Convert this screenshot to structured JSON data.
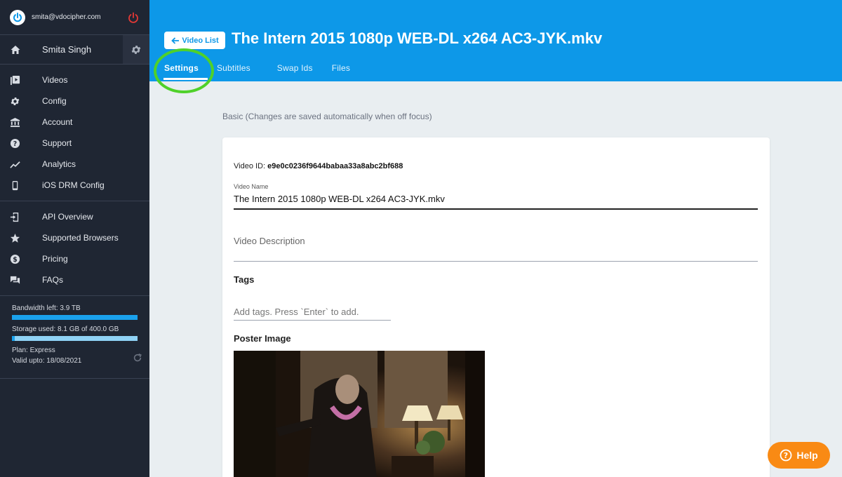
{
  "account": {
    "email": "smita@vdocipher.com"
  },
  "user": {
    "name": "Smita Singh"
  },
  "nav_primary": [
    {
      "label": "Videos",
      "icon": "video-library-icon"
    },
    {
      "label": "Config",
      "icon": "gear-icon"
    },
    {
      "label": "Account",
      "icon": "bank-icon"
    },
    {
      "label": "Support",
      "icon": "help-circle-icon"
    },
    {
      "label": "Analytics",
      "icon": "trend-line-icon"
    },
    {
      "label": "iOS DRM Config",
      "icon": "phone-icon"
    }
  ],
  "nav_secondary": [
    {
      "label": "API Overview",
      "icon": "api-door-icon"
    },
    {
      "label": "Supported Browsers",
      "icon": "star-icon"
    },
    {
      "label": "Pricing",
      "icon": "dollar-circle-icon"
    },
    {
      "label": "FAQs",
      "icon": "forum-icon"
    }
  ],
  "usage": {
    "bandwidth_label": "Bandwidth left: 3.9 TB",
    "bandwidth_fraction": 1.0,
    "storage_label": "Storage used: 8.1 GB of 400.0 GB",
    "storage_fraction": 0.02,
    "plan": "Plan: Express",
    "valid": "Valid upto: 18/08/2021"
  },
  "header": {
    "back_label": "Video List",
    "title": "The Intern 2015 1080p WEB-DL x264 AC3-JYK.mkv",
    "tabs": [
      "Settings",
      "Subtitles",
      "Swap Ids",
      "Files"
    ],
    "active_tab": "Settings"
  },
  "main": {
    "note": "Basic (Changes are saved automatically when off focus)",
    "video_id_label": "Video ID:",
    "video_id": "e9e0c0236f9644babaa33a8abc2bf688",
    "video_name_label": "Video Name",
    "video_name": "The Intern 2015 1080p WEB-DL x264 AC3-JYK.mkv",
    "description_placeholder": "Video Description",
    "tags_heading": "Tags",
    "tags_placeholder": "Add tags. Press `Enter` to add.",
    "poster_heading": "Poster Image"
  },
  "help": {
    "label": "Help"
  },
  "colors": {
    "header_blue": "#0d98e8",
    "sidebar_bg": "#1f2633",
    "bandwidth_bar": "#1aa1ec",
    "storage_bar": "#8fd2f5",
    "help_orange": "#f98a14",
    "highlight_green": "#4fd12a"
  }
}
